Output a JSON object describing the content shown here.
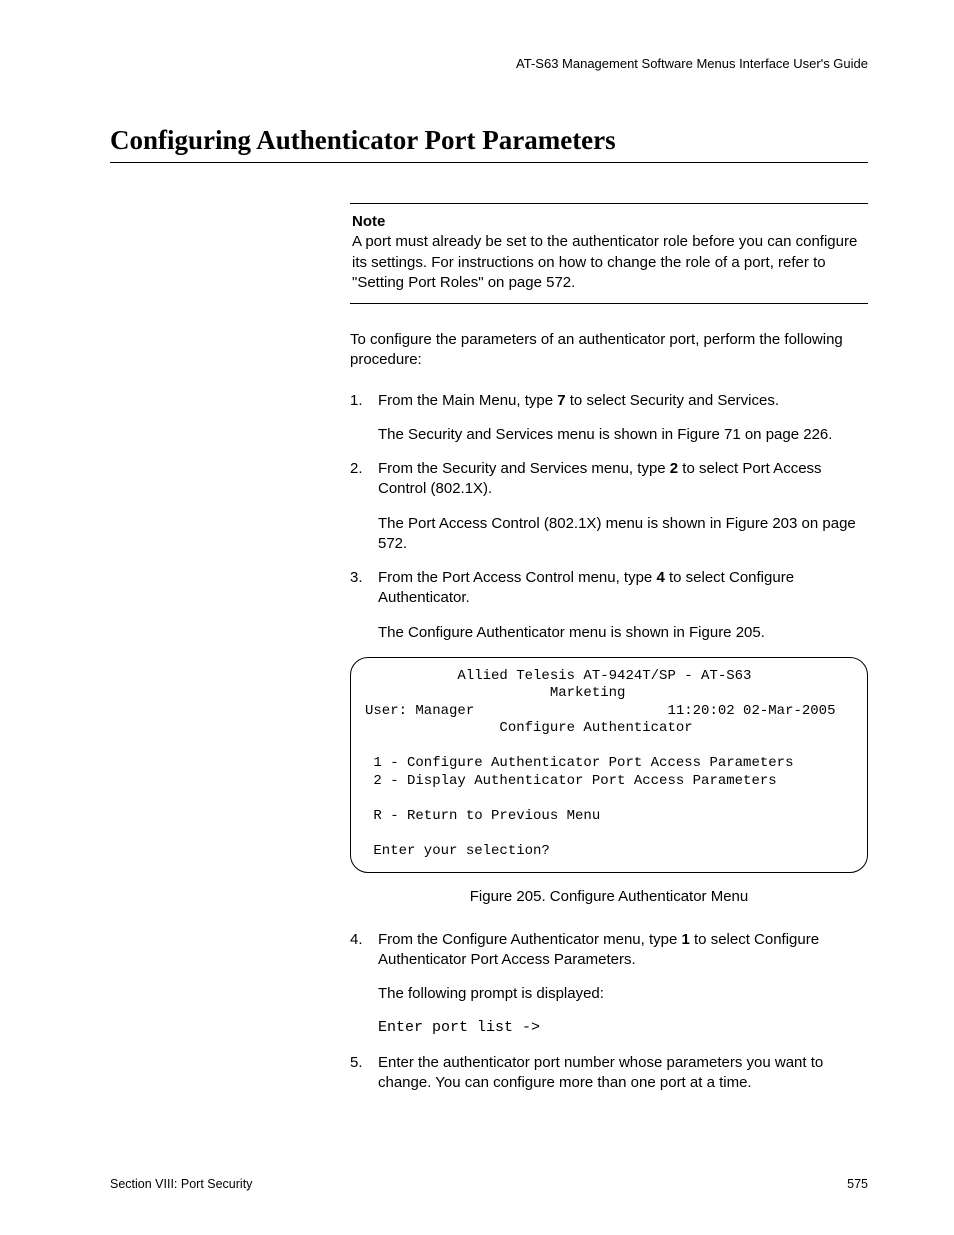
{
  "runningHead": "AT-S63 Management Software Menus Interface User's Guide",
  "title": "Configuring Authenticator Port Parameters",
  "note": {
    "label": "Note",
    "text": "A port must already be set to the authenticator role before you can configure its settings. For instructions on how to change the role of a port, refer to \"Setting Port Roles\" on page 572."
  },
  "intro": "To configure the parameters of an authenticator port, perform the following procedure:",
  "steps": {
    "s1": {
      "num": "1.",
      "a": "From the Main Menu, type ",
      "b": "7",
      "c": " to select Security and Services.",
      "sub": "The Security and Services menu is shown in Figure 71 on page 226."
    },
    "s2": {
      "num": "2.",
      "a": "From the Security and Services menu, type ",
      "b": "2",
      "c": " to select Port Access Control (802.1X).",
      "sub": "The Port Access Control (802.1X) menu is shown in Figure 203 on page 572."
    },
    "s3": {
      "num": "3.",
      "a": "From the Port Access Control menu, type ",
      "b": "4",
      "c": " to select Configure Authenticator.",
      "sub": "The Configure Authenticator menu is shown in Figure 205."
    },
    "s4": {
      "num": "4.",
      "a": "From the Configure Authenticator menu, type ",
      "b": "1",
      "c": " to select Configure Authenticator Port Access Parameters.",
      "sub": "The following prompt is displayed:",
      "prompt": "Enter port list ->"
    },
    "s5": {
      "num": "5.",
      "text": "Enter the authenticator port number whose parameters you want to change. You can configure more than one port at a time."
    }
  },
  "terminal": "           Allied Telesis AT-9424T/SP - AT-S63\n                      Marketing\nUser: Manager                       11:20:02 02-Mar-2005\n                Configure Authenticator\n\n 1 - Configure Authenticator Port Access Parameters\n 2 - Display Authenticator Port Access Parameters\n\n R - Return to Previous Menu\n\n Enter your selection?",
  "figCaption": "Figure 205. Configure Authenticator Menu",
  "footer": {
    "left": "Section VIII: Port Security",
    "right": "575"
  }
}
